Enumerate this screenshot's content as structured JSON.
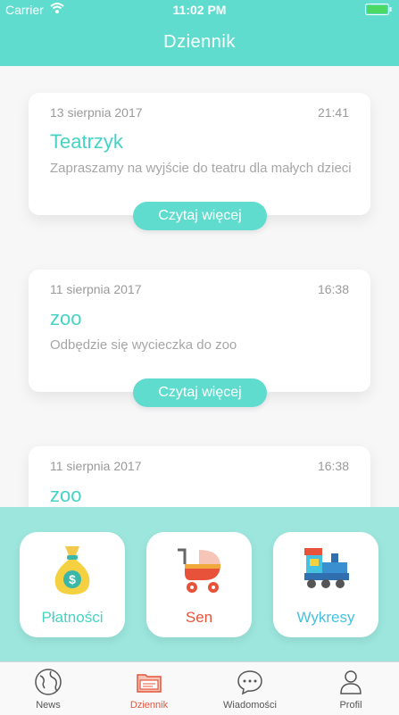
{
  "status_bar": {
    "carrier": "Carrier",
    "time": "11:02 PM"
  },
  "nav": {
    "title": "Dziennik"
  },
  "feed": [
    {
      "date": "13 sierpnia 2017",
      "time": "21:41",
      "title": "Teatrzyk",
      "description": "Zapraszamy na wyjście do teatru dla małych dzieci",
      "button": "Czytaj więcej"
    },
    {
      "date": "11 sierpnia 2017",
      "time": "16:38",
      "title": "zoo",
      "description": "Odbędzie się wycieczka do zoo",
      "button": "Czytaj więcej"
    },
    {
      "date": "11 sierpnia 2017",
      "time": "16:38",
      "title": "zoo"
    }
  ],
  "quick_actions": [
    {
      "label": "Płatności",
      "icon": "money-bag-icon",
      "color": "#45d3c4"
    },
    {
      "label": "Sen",
      "icon": "stroller-icon",
      "color": "#e5553a"
    },
    {
      "label": "Wykresy",
      "icon": "toy-train-icon",
      "color": "#45c2e0"
    }
  ],
  "tab_bar": {
    "active": "Dziennik",
    "items": [
      {
        "label": "News",
        "icon": "globe-icon"
      },
      {
        "label": "Dziennik",
        "icon": "folder-icon"
      },
      {
        "label": "Wiadomości",
        "icon": "chat-bubble-icon"
      },
      {
        "label": "Profil",
        "icon": "person-icon"
      }
    ]
  },
  "colors": {
    "accent": "#5fdcce",
    "panel": "#9ce6dd",
    "title": "#45d3c4",
    "active_tab": "#e5553a"
  }
}
